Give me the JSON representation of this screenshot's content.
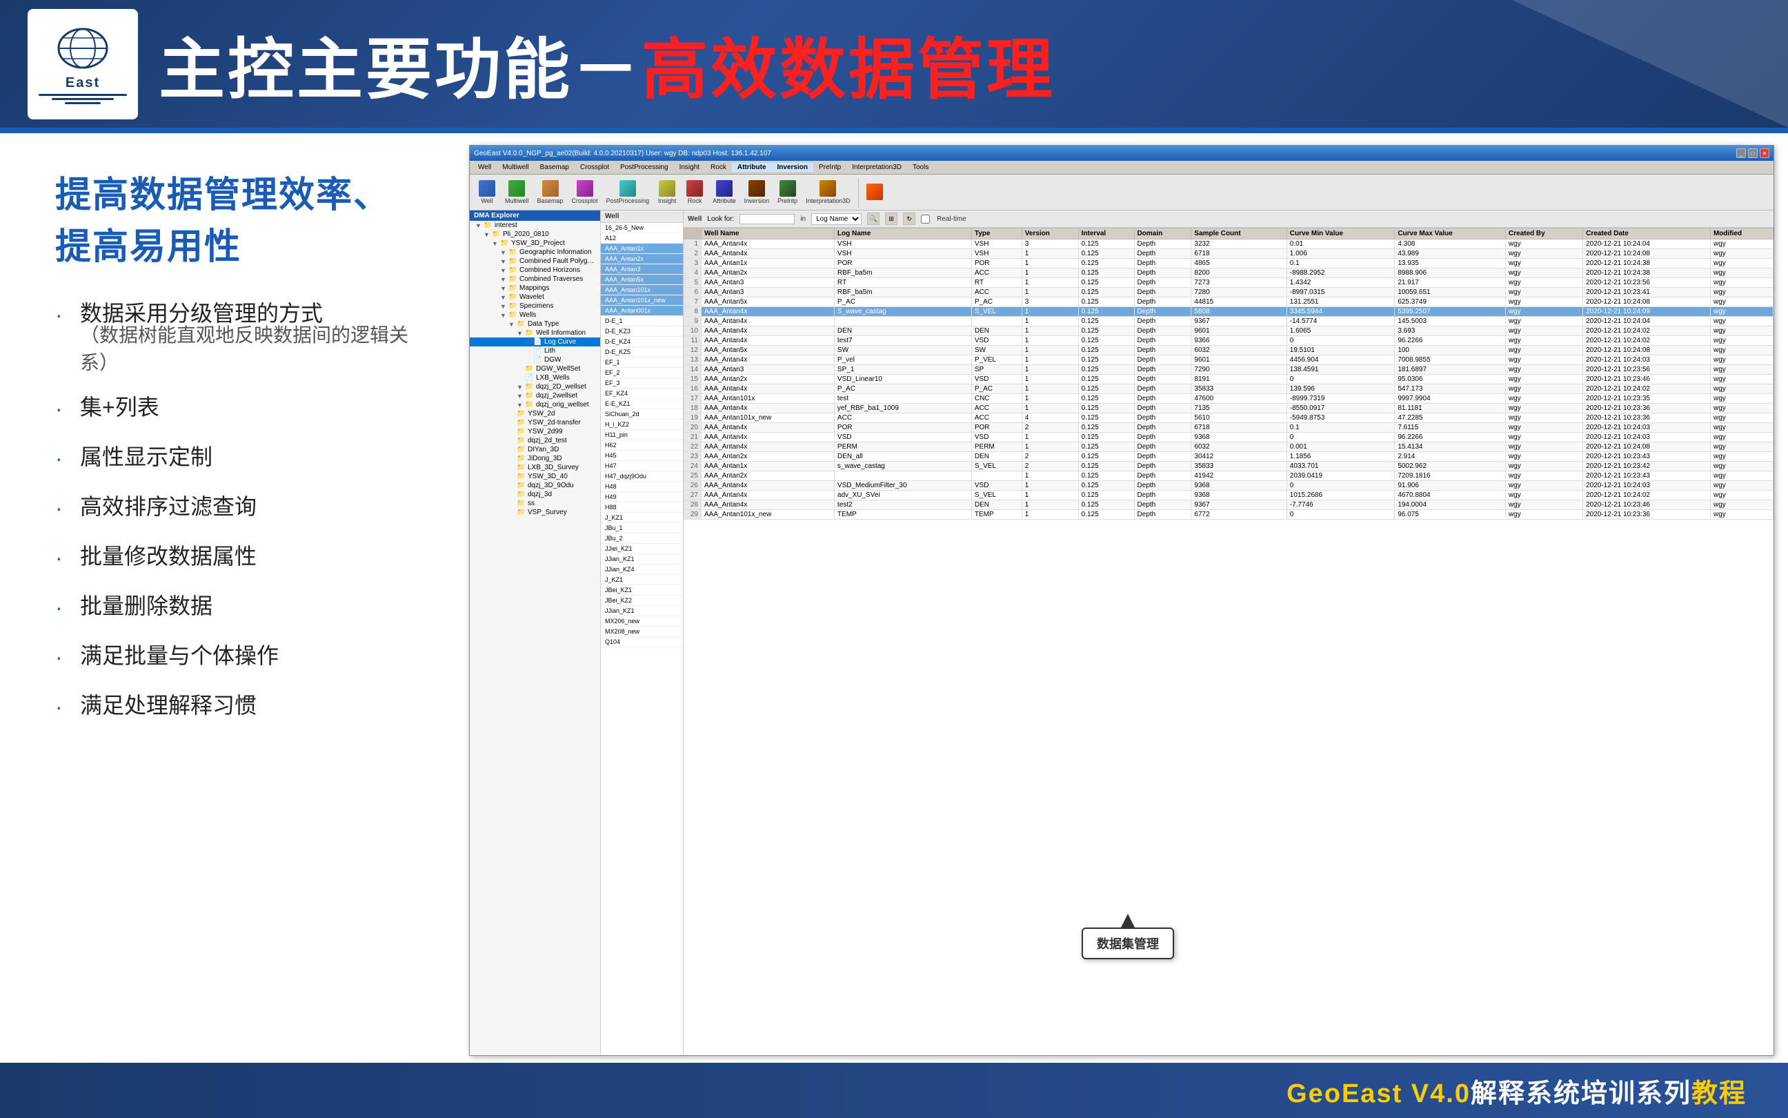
{
  "header": {
    "logo_text": "GeoEast",
    "logo_sub": "East",
    "title_part1": "主控主要功能－",
    "title_part2": "高效数据管理",
    "company": "GeoEast"
  },
  "subtitle": "提高数据管理效率、提高易用性",
  "bullets": [
    {
      "main": "数据采用分级管理的方式",
      "sub": "（数据树能直观地反映数据间的逻辑关系）"
    },
    {
      "main": "集+列表",
      "sub": ""
    },
    {
      "main": "属性显示定制",
      "sub": ""
    },
    {
      "main": "高效排序过滤查询",
      "sub": ""
    },
    {
      "main": "批量修改数据属性",
      "sub": ""
    },
    {
      "main": "批量删除数据",
      "sub": ""
    },
    {
      "main": "满足批量与个体操作",
      "sub": ""
    },
    {
      "main": "满足处理解释习惯",
      "sub": ""
    }
  ],
  "geoeast_window": {
    "title": "GeoEast V4.0.0_NGP_pg_ae02(Build: 4.0.0.20210317)  User: wgy  DB: ndp03  Host: 136.1.42.107",
    "menu": [
      "Well",
      "Multiwell",
      "Basemap",
      "Crossplot",
      "PostProcessing",
      "Insight",
      "Rock",
      "Attribute",
      "Inversion",
      "PreIntp",
      "Interpretation3D",
      "Tools"
    ],
    "toolbar_labels": [
      "Well",
      "Multiwell",
      "Basemap",
      "Crossplot",
      "PostProcessing",
      "Insight",
      "Rock",
      "Attribute",
      "Inversion",
      "PreIntp",
      "Interpretation3D"
    ],
    "dma_explorer": "DMA Explorer",
    "tree_nodes": [
      {
        "indent": 0,
        "expand": "▼",
        "icon": "📁",
        "text": "interest"
      },
      {
        "indent": 1,
        "expand": "▼",
        "icon": "📁",
        "text": "Pli_2020_0810"
      },
      {
        "indent": 2,
        "expand": "▼",
        "icon": "📁",
        "text": "YSW_3D_Project"
      },
      {
        "indent": 3,
        "expand": "▼",
        "icon": "📁",
        "text": "Geographic Information"
      },
      {
        "indent": 3,
        "expand": "▼",
        "icon": "📁",
        "text": "Combined Fault Polygons"
      },
      {
        "indent": 3,
        "expand": "▼",
        "icon": "📁",
        "text": "Combined Horizons"
      },
      {
        "indent": 3,
        "expand": "▼",
        "icon": "📁",
        "text": "Combined Traverses"
      },
      {
        "indent": 3,
        "expand": "▼",
        "icon": "📁",
        "text": "Mappings"
      },
      {
        "indent": 3,
        "expand": "▼",
        "icon": "📁",
        "text": "Wavelet"
      },
      {
        "indent": 3,
        "expand": "▼",
        "icon": "📁",
        "text": "Specimens"
      },
      {
        "indent": 3,
        "expand": "▼",
        "icon": "📁",
        "text": "Wells"
      },
      {
        "indent": 4,
        "expand": "▼",
        "icon": "📁",
        "text": "Data Type"
      },
      {
        "indent": 5,
        "expand": "▼",
        "icon": "📁",
        "text": "Well Information"
      },
      {
        "indent": 6,
        "expand": "▼",
        "icon": "📄",
        "text": "Log Curve",
        "selected": true
      },
      {
        "indent": 6,
        "expand": "",
        "icon": "📄",
        "text": "Lith"
      },
      {
        "indent": 6,
        "expand": "",
        "icon": "📄",
        "text": "DGW"
      },
      {
        "indent": 5,
        "expand": "",
        "icon": "📁",
        "text": "DGW_WellSet"
      },
      {
        "indent": 5,
        "expand": "",
        "icon": "📄",
        "text": "LXB_Wells"
      },
      {
        "indent": 5,
        "expand": "▼",
        "icon": "📁",
        "text": "dqzj_2D_wellset"
      },
      {
        "indent": 5,
        "expand": "▼",
        "icon": "📁",
        "text": "dqzj_2wellset"
      },
      {
        "indent": 5,
        "expand": "▼",
        "icon": "📁",
        "text": "dqzj_orig_wellset"
      },
      {
        "indent": 4,
        "expand": "",
        "icon": "📁",
        "text": "YSW_2d"
      },
      {
        "indent": 4,
        "expand": "",
        "icon": "📁",
        "text": "YSW_2d-transfer"
      },
      {
        "indent": 4,
        "expand": "",
        "icon": "📁",
        "text": "YSW_2d99"
      },
      {
        "indent": 4,
        "expand": "",
        "icon": "📁",
        "text": "dqzj_2d_test"
      },
      {
        "indent": 4,
        "expand": "",
        "icon": "📁",
        "text": "DIYan_3D"
      },
      {
        "indent": 4,
        "expand": "",
        "icon": "📁",
        "text": "JiDong_3D"
      },
      {
        "indent": 4,
        "expand": "",
        "icon": "📁",
        "text": "LXB_3D_Survey"
      },
      {
        "indent": 4,
        "expand": "",
        "icon": "📁",
        "text": "YSW_3D_40"
      },
      {
        "indent": 4,
        "expand": "",
        "icon": "📁",
        "text": "dqzj_3D_9Odu"
      },
      {
        "indent": 4,
        "expand": "",
        "icon": "📁",
        "text": "dqzj_3d"
      },
      {
        "indent": 4,
        "expand": "",
        "icon": "📁",
        "text": "ss"
      },
      {
        "indent": 4,
        "expand": "",
        "icon": "📁",
        "text": "VSP_Survey"
      }
    ],
    "wells": [
      "16_26-5_New",
      "A12",
      "AAA_Antan1x",
      "AAA_Antan2x",
      "AAA_Antan3",
      "AAA_Antan5x",
      "AAA_Antan101x",
      "AAA_Antan101x_new",
      "AAA_Antan001x",
      "D-E_1",
      "D-E_KZ3",
      "D-E_KZ4",
      "D-E_KZ5",
      "EF_1",
      "EF_2",
      "EF_3",
      "EF_KZ4",
      "E-E_KZ1",
      "SiChuan_2d",
      "H_i_KZ2",
      "H11_pin",
      "H62",
      "H45",
      "H47",
      "H47_dqzj9Odu",
      "H48",
      "H49",
      "H88",
      "J_KZ1",
      "JBu_1",
      "JBu_2",
      "JJiei_KZ1",
      "JJian_KZ1",
      "JJian_KZ4",
      "J_KZ1",
      "JBei_KZ1",
      "JBei_KZ2",
      "JJian_KZ1",
      "MX206_new",
      "MX208_new",
      "Q104"
    ],
    "table_columns": [
      "",
      "Well Name",
      "Log Name",
      "Type",
      "Version",
      "Interval",
      "Domain",
      "Sample Count",
      "Curve Min Value",
      "Curve Max Value",
      "Created By",
      "Created Date",
      "Modified"
    ],
    "table_rows": [
      [
        "1",
        "AAA_Antan4x",
        "VSH",
        "VSH",
        "3",
        "0.125",
        "Depth",
        "3232",
        "0.01",
        "4.308",
        "wgy",
        "2020-12-21 10:24:04",
        "wgy"
      ],
      [
        "2",
        "AAA_Antan4x",
        "VSH",
        "VSH",
        "1",
        "0.125",
        "Depth",
        "6718",
        "1.006",
        "43.989",
        "wgy",
        "2020-12-21 10:24:08",
        "wgy"
      ],
      [
        "3",
        "AAA_Antan1x",
        "POR",
        "POR",
        "1",
        "0.125",
        "Depth",
        "4865",
        "0.1",
        "13.935",
        "wgy",
        "2020-12-21 10:24:38",
        "wgy"
      ],
      [
        "4",
        "AAA_Antan2x",
        "RBF_ba5m",
        "ACC",
        "1",
        "0.125",
        "Depth",
        "8200",
        "-8988.2952",
        "8988.906",
        "wgy",
        "2020-12-21 10:24:38",
        "wgy"
      ],
      [
        "5",
        "AAA_Antan3",
        "RT",
        "RT",
        "1",
        "0.125",
        "Depth",
        "7273",
        "1.4342",
        "21.917",
        "wgy",
        "2020-12-21 10:23:56",
        "wgy"
      ],
      [
        "6",
        "AAA_Antan3",
        "RBF_ba5m",
        "ACC",
        "1",
        "0.125",
        "Depth",
        "7280",
        "-8997.0315",
        "10059.651",
        "wgy",
        "2020-12-21 10:23:41",
        "wgy"
      ],
      [
        "7",
        "AAA_Antan5x",
        "P_AC",
        "P_AC",
        "3",
        "0.125",
        "Depth",
        "44815",
        "131.2551",
        "625.3749",
        "wgy",
        "2020-12-21 10:24:08",
        "wgy"
      ],
      [
        "8",
        "AAA_Antan4x",
        "S_wave_castag",
        "S_VEL",
        "1",
        "0.125",
        "Depth",
        "5808",
        "3345.5944",
        "5395.2507",
        "wgy",
        "2020-12-21 10:24:09",
        "wgy"
      ],
      [
        "9",
        "AAA_Antan4x",
        "",
        "",
        "1",
        "0.125",
        "Depth",
        "9367",
        "-14.5774",
        "145.5003",
        "wgy",
        "2020-12-21 10:24:04",
        "wgy"
      ],
      [
        "10",
        "AAA_Antan4x",
        "DEN",
        "DEN",
        "1",
        "0.125",
        "Depth",
        "9601",
        "1.6065",
        "3.693",
        "wgy",
        "2020-12-21 10:24:02",
        "wgy"
      ],
      [
        "11",
        "AAA_Antan4x",
        "test7",
        "VSD",
        "1",
        "0.125",
        "Depth",
        "9366",
        "0",
        "96.2266",
        "wgy",
        "2020-12-21 10:24:02",
        "wgy"
      ],
      [
        "12",
        "AAA_Antan5x",
        "SW",
        "SW",
        "1",
        "0.125",
        "Depth",
        "6032",
        "19.5101",
        "100",
        "wgy",
        "2020-12-21 10:24:08",
        "wgy"
      ],
      [
        "13",
        "AAA_Antan4x",
        "P_vel",
        "P_VEL",
        "1",
        "0.125",
        "Depth",
        "9601",
        "4456.904",
        "7008.9855",
        "wgy",
        "2020-12-21 10:24:03",
        "wgy"
      ],
      [
        "14",
        "AAA_Antan3",
        "SP_1",
        "SP",
        "1",
        "0.125",
        "Depth",
        "7290",
        "138.4591",
        "181.6897",
        "wgy",
        "2020-12-21 10:23:56",
        "wgy"
      ],
      [
        "15",
        "AAA_Antan2x",
        "VSD_Linear10",
        "VSD",
        "1",
        "0.125",
        "Depth",
        "8191",
        "0",
        "95.0306",
        "wgy",
        "2020-12-21 10:23:46",
        "wgy"
      ],
      [
        "16",
        "AAA_Antan4x",
        "P_AC",
        "P_AC",
        "1",
        "0.125",
        "Depth",
        "35833",
        "139.596",
        "547.173",
        "wgy",
        "2020-12-21 10:24:02",
        "wgy"
      ],
      [
        "17",
        "AAA_Antan101x",
        "test",
        "CNC",
        "1",
        "0.125",
        "Depth",
        "47600",
        "-8999.7319",
        "9997.9904",
        "wgy",
        "2020-12-21 10:23:35",
        "wgy"
      ],
      [
        "18",
        "AAA_Antan4x",
        "yef_RBF_ba1_1009",
        "ACC",
        "1",
        "0.125",
        "Depth",
        "7135",
        "-8550.0917",
        "81.1181",
        "wgy",
        "2020-12-21 10:23:36",
        "wgy"
      ],
      [
        "19",
        "AAA_Antan101x_new",
        "ACC",
        "ACC",
        "4",
        "0.125",
        "Depth",
        "5610",
        "-5949.8753",
        "47.2285",
        "wgy",
        "2020-12-21 10:23:36",
        "wgy"
      ],
      [
        "20",
        "AAA_Antan4x",
        "POR",
        "POR",
        "2",
        "0.125",
        "Depth",
        "6718",
        "0.1",
        "7.6115",
        "wgy",
        "2020-12-21 10:24:03",
        "wgy"
      ],
      [
        "21",
        "AAA_Antan4x",
        "VSD",
        "VSD",
        "1",
        "0.125",
        "Depth",
        "9368",
        "0",
        "96.2266",
        "wgy",
        "2020-12-21 10:24:03",
        "wgy"
      ],
      [
        "22",
        "AAA_Antan4x",
        "PERM",
        "PERM",
        "1",
        "0.125",
        "Depth",
        "6032",
        "0.001",
        "15.4134",
        "wgy",
        "2020-12-21 10:24:08",
        "wgy"
      ],
      [
        "23",
        "AAA_Antan2x",
        "DEN_all",
        "DEN",
        "2",
        "0.125",
        "Depth",
        "30412",
        "1.1856",
        "2.914",
        "wgy",
        "2020-12-21 10:23:43",
        "wgy"
      ],
      [
        "24",
        "AAA_Antan1x",
        "s_wave_castag",
        "S_VEL",
        "2",
        "0.125",
        "Depth",
        "35833",
        "4033.701",
        "5002.962",
        "wgy",
        "2020-12-21 10:23:42",
        "wgy"
      ],
      [
        "25",
        "AAA_Antan2x",
        "",
        "",
        "1",
        "0.125",
        "Depth",
        "41942",
        "2039.0419",
        "7209.1816",
        "wgy",
        "2020-12-21 10:23:43",
        "wgy"
      ],
      [
        "26",
        "AAA_Antan4x",
        "VSD_MediumFilter_30",
        "VSD",
        "1",
        "0.125",
        "Depth",
        "9368",
        "0",
        "91.906",
        "wgy",
        "2020-12-21 10:24:03",
        "wgy"
      ],
      [
        "27",
        "AAA_Antan4x",
        "adv_XU_SVei",
        "S_VEL",
        "1",
        "0.125",
        "Depth",
        "9368",
        "1015.2686",
        "4670.8804",
        "wgy",
        "2020-12-21 10:24:02",
        "wgy"
      ],
      [
        "28",
        "AAA_Antan4x",
        "test2",
        "DEN",
        "1",
        "0.125",
        "Depth",
        "9367",
        "-7.7746",
        "194.0004",
        "wgy",
        "2020-12-21 10:23:46",
        "wgy"
      ],
      [
        "29",
        "AAA_Antan101x_new",
        "TEMP",
        "TEMP",
        "1",
        "0.125",
        "Depth",
        "6772",
        "0",
        "96.075",
        "wgy",
        "2020-12-21 10:23:36",
        "wgy"
      ]
    ],
    "well_label": "Well",
    "look_for_label": "Look for:",
    "in_label": "in",
    "log_name_option": "Log Name",
    "realtime_label": "Real-time",
    "callout": "数据集管理"
  },
  "footer": {
    "text": "GeoEast V4.0解释系统培训系列教程"
  },
  "icons": {
    "well": "🔬",
    "multiwell": "🔬",
    "basemap": "🗺",
    "crossplot": "📊",
    "postprocessing": "⚙",
    "insight": "💡",
    "rock": "🪨",
    "attribute": "📋",
    "inversion": "🔄",
    "preint": "📐",
    "interp3d": "🌐",
    "fire": "🔥"
  }
}
